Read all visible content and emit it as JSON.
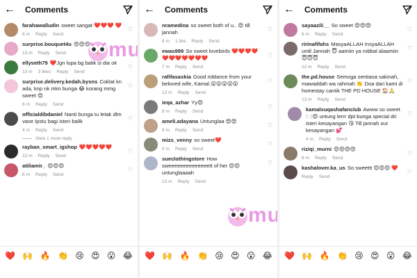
{
  "header": {
    "title": "Comments"
  },
  "panels": [
    {
      "comments": [
        {
          "user": "farahawalludin",
          "text": "sweet sangat ❤️❤️❤️ ❤️",
          "time": "6 m",
          "likes": "",
          "reply": "Reply",
          "send": "Send",
          "avatar_color": "#b58a6b"
        },
        {
          "user": "surprise.bouquet4u",
          "text": "😍😍😍",
          "time": "13 m",
          "likes": "",
          "reply": "Reply",
          "send": "Send",
          "avatar_color": "#e7a9c8"
        },
        {
          "user": "ellyseth79",
          "text": "❤️Jgn lupa bg balik si dia ok",
          "time": "13 m",
          "likes": "3 likes",
          "reply": "Reply",
          "send": "Send",
          "avatar_color": "#3b7a3d"
        },
        {
          "user": "surprise.delivery.kedah.bysns",
          "text": "Coklat kn ada, knp nk mkn bunga 😂 korang mmg sweet 😍",
          "time": "6 m",
          "likes": "",
          "reply": "Reply",
          "send": "Send",
          "avatar_color": "#f3c6da"
        },
        {
          "user": "officialdibdaniel",
          "text": "Nanti bunga tu letak dlm vase Ipstu bagi isteri balik",
          "time": "4 m",
          "likes": "",
          "reply": "Reply",
          "send": "Send",
          "avatar_color": "#4b4b4b"
        },
        {
          "user": "rayban_smart_igshop",
          "text": "❤️❤️❤️❤️❤️",
          "time": "12 m",
          "likes": "",
          "reply": "Reply",
          "send": "Send",
          "avatar_color": "#2b2b2b"
        },
        {
          "user": "atiliamir_",
          "text": "😍😍😍",
          "time": "6 m",
          "likes": "",
          "reply": "Reply",
          "send": "Send",
          "avatar_color": "#c9576a"
        }
      ],
      "view_replies": "View 1 more reply",
      "watermark": "murai"
    },
    {
      "comments": [
        {
          "user": "nramedina",
          "text": "so sweet both of u.. 😍 till jannah",
          "time": "6 m",
          "likes": "1 like",
          "reply": "Reply",
          "send": "Send",
          "avatar_color": "#d9b8b8"
        },
        {
          "user": "ewas999",
          "text": "So sweet lovebirds ❤️❤️❤️❤️❤️❤️❤️❤️❤️❤️❤️",
          "time": "7 m",
          "likes": "",
          "reply": "Reply",
          "send": "Send",
          "avatar_color": "#6aa86a"
        },
        {
          "user": "rafifasaskia",
          "text": "Good riddance from your beloved wife, Kamal.😮😮😮😮😮",
          "time": "13 m",
          "likes": "",
          "reply": "Reply",
          "send": "Send",
          "avatar_color": "#b9a07a"
        },
        {
          "user": "ieqa_azhar",
          "text": "Yy😍",
          "time": "8 m",
          "likes": "",
          "reply": "Reply",
          "send": "Send",
          "avatar_color": "#7a7a7a"
        },
        {
          "user": "ameli.adayana",
          "text": "Untunglaa 😍😍",
          "time": "9 m",
          "likes": "",
          "reply": "Reply",
          "send": "Send",
          "avatar_color": "#bfa089"
        },
        {
          "user": "mizs_venny",
          "text": "so sweet❤️",
          "time": "5 m",
          "likes": "",
          "reply": "Reply",
          "send": "Send",
          "avatar_color": "#8a8a7a"
        },
        {
          "user": "sueclothingstore",
          "text": "How sweeeeeeeeeeeeeett of her 😍😍 untunglaaaah",
          "time": "13 m",
          "likes": "",
          "reply": "Reply",
          "send": "Send",
          "avatar_color": "#b0b6c9"
        }
      ],
      "watermark": "murai"
    },
    {
      "comments": [
        {
          "user": "sayaazili__",
          "text": "So sweet 😍😍😍",
          "time": "6 m",
          "likes": "",
          "reply": "Reply",
          "send": "Send",
          "avatar_color": "#c07aa0"
        },
        {
          "user": "ririnafifahs",
          "text": "MasyaALLAH InsyaALLAH until Jannah 😇 aamiin ya robbal alaamiin 😇😇😇",
          "time": "12 m",
          "likes": "",
          "reply": "Reply",
          "send": "Send",
          "avatar_color": "#7a6a6a"
        },
        {
          "user": "the.pd.house",
          "text": "Semoga sentiasa sakinah, mawaddah wa rahmah 👏 Doa dari kami di homestay cantik THE PD HOUSE 🏠🙏",
          "time": "13 m",
          "likes": "",
          "reply": "Reply",
          "send": "Send",
          "avatar_color": "#6c8a5a"
        },
        {
          "user": "kamalxuqashafanclub",
          "text": "Awww so sweet 🍽️😍 untung lerrr dpt bunga special dri isteri kesayangan 😘 Till jannah our kesayangan 💕",
          "time": "4 m",
          "likes": "",
          "reply": "Reply",
          "send": "Send",
          "avatar_color": "#a08aa8",
          "is_reply": true
        },
        {
          "user": "riziqi_murni",
          "text": "😍😍😍😍",
          "time": "6 m",
          "likes": "",
          "reply": "Reply",
          "send": "Send",
          "avatar_color": "#8a7a6a"
        },
        {
          "user": "kashalover.ka_us",
          "text": "So sweettt 😍😍😍 ❤️",
          "time": "",
          "likes": "",
          "reply": "Reply",
          "send": "Send",
          "avatar_color": "#5a4a4a"
        }
      ]
    }
  ],
  "emoji_bar": [
    "❤️",
    "🙌",
    "🔥",
    "👏",
    "😢",
    "😍",
    "😮",
    "😂"
  ],
  "icons": {
    "back": "back-arrow-icon",
    "send": "send-paper-plane-icon",
    "heart": "heart-outline-icon"
  }
}
